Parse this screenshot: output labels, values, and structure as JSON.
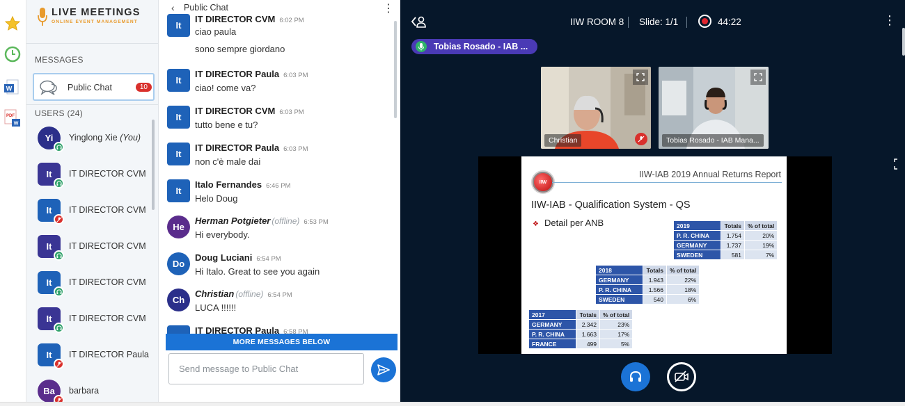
{
  "app": {
    "logo_title": "LIVE MEETINGS",
    "logo_subtitle": "ONLINE EVENT MANAGEMENT"
  },
  "rail": {
    "icons": [
      "star-icon",
      "clock-icon",
      "word-doc-icon",
      "pdf-doc-icon"
    ]
  },
  "userlist": {
    "messages_label": "MESSAGES",
    "public_chat_label": "Public Chat",
    "public_chat_badge": "10",
    "users_label": "USERS (24)",
    "users": [
      {
        "initials": "Yi",
        "name": "Yinglong Xie",
        "suffix": "(You)",
        "color": "#2b2f8a",
        "status": "audio"
      },
      {
        "initials": "It",
        "name": "IT DIRECTOR CVM",
        "suffix": "",
        "color": "#3a3594",
        "status": "audio"
      },
      {
        "initials": "It",
        "name": "IT DIRECTOR CVM",
        "suffix": "",
        "color": "#1e62b8",
        "status": "muted"
      },
      {
        "initials": "It",
        "name": "IT DIRECTOR CVM",
        "suffix": "",
        "color": "#3a3594",
        "status": "audio"
      },
      {
        "initials": "It",
        "name": "IT DIRECTOR CVM",
        "suffix": "",
        "color": "#1e62b8",
        "status": "audio"
      },
      {
        "initials": "It",
        "name": "IT DIRECTOR CVM",
        "suffix": "",
        "color": "#3a3594",
        "status": "audio"
      },
      {
        "initials": "It",
        "name": "IT DIRECTOR Paula",
        "suffix": "",
        "color": "#1e62b8",
        "status": "muted"
      },
      {
        "initials": "Ba",
        "name": "barbara",
        "suffix": "",
        "color": "#5a2c8c",
        "status": "muted"
      }
    ]
  },
  "chat": {
    "title": "Public Chat",
    "more_below": "MORE MESSAGES BELOW",
    "input_placeholder": "Send message to Public Chat",
    "messages": [
      {
        "initials": "It",
        "sender": "IT DIRECTOR CVM",
        "offline": "",
        "time": "6:02 PM",
        "lines": [
          "ciao paula",
          "sono sempre giordano"
        ],
        "color": "#1e62b8"
      },
      {
        "initials": "It",
        "sender": "IT DIRECTOR Paula",
        "offline": "",
        "time": "6:03 PM",
        "lines": [
          "ciao! come va?"
        ],
        "color": "#1e62b8"
      },
      {
        "initials": "It",
        "sender": "IT DIRECTOR CVM",
        "offline": "",
        "time": "6:03 PM",
        "lines": [
          "tutto bene e tu?"
        ],
        "color": "#1e62b8"
      },
      {
        "initials": "It",
        "sender": "IT DIRECTOR Paula",
        "offline": "",
        "time": "6:03 PM",
        "lines": [
          "non c'è male dai"
        ],
        "color": "#1e62b8"
      },
      {
        "initials": "It",
        "sender": "Italo Fernandes",
        "offline": "",
        "time": "6:46 PM",
        "lines": [
          "Helo Doug"
        ],
        "color": "#1e62b8"
      },
      {
        "initials": "He",
        "sender": "Herman Potgieter",
        "offline": "(offline)",
        "time": "6:53 PM",
        "lines": [
          "Hi everybody."
        ],
        "color": "#5a2c8c"
      },
      {
        "initials": "Do",
        "sender": "Doug Luciani",
        "offline": "",
        "time": "6:54 PM",
        "lines": [
          "Hi Italo. Great to see you again"
        ],
        "color": "#1e62b8"
      },
      {
        "initials": "Ch",
        "sender": "Christian",
        "offline": "(offline)",
        "time": "6:54 PM",
        "lines": [
          "LUCA !!!!!!"
        ],
        "color": "#2b2f8a"
      },
      {
        "initials": "It",
        "sender": "IT DIRECTOR Paula",
        "offline": "",
        "time": "6:58 PM",
        "lines": [],
        "color": "#1e62b8"
      }
    ]
  },
  "stage": {
    "room": "IIW ROOM 8",
    "slide": "Slide: 1/1",
    "timer": "44:22",
    "talker": "Tobias Rosado - IAB ...",
    "cams": [
      {
        "name": "Christian"
      },
      {
        "name": "Tobias Rosado - IAB Mana..."
      }
    ]
  },
  "slide": {
    "title": "IIW-IAB 2019 Annual Returns Report",
    "logo_text": "IIW",
    "heading": "IIW-IAB  - Qualification System - QS",
    "bullet": "Detail per ANB",
    "tables": [
      {
        "year": "2019",
        "h_tot": "Totals",
        "h_pct": "% of total",
        "rows": [
          [
            "P. R. CHINA",
            "1.754",
            "20%"
          ],
          [
            "GERMANY",
            "1.737",
            "19%"
          ],
          [
            "SWEDEN",
            "581",
            "7%"
          ]
        ]
      },
      {
        "year": "2018",
        "h_tot": "Totals",
        "h_pct": "% of total",
        "rows": [
          [
            "GERMANY",
            "1.943",
            "22%"
          ],
          [
            "P. R. CHINA",
            "1.566",
            "18%"
          ],
          [
            "SWEDEN",
            "540",
            "6%"
          ]
        ]
      },
      {
        "year": "2017",
        "h_tot": "Totals",
        "h_pct": "% of total",
        "rows": [
          [
            "GERMANY",
            "2.342",
            "23%"
          ],
          [
            "P. R. CHINA",
            "1.663",
            "17%"
          ],
          [
            "FRANCE",
            "499",
            "5%"
          ]
        ]
      }
    ]
  },
  "colors": {
    "accent": "#1b73d6",
    "stage_bg": "#06172a",
    "badge_red": "#d9302c",
    "talker_bg": "#4a3ab5"
  }
}
